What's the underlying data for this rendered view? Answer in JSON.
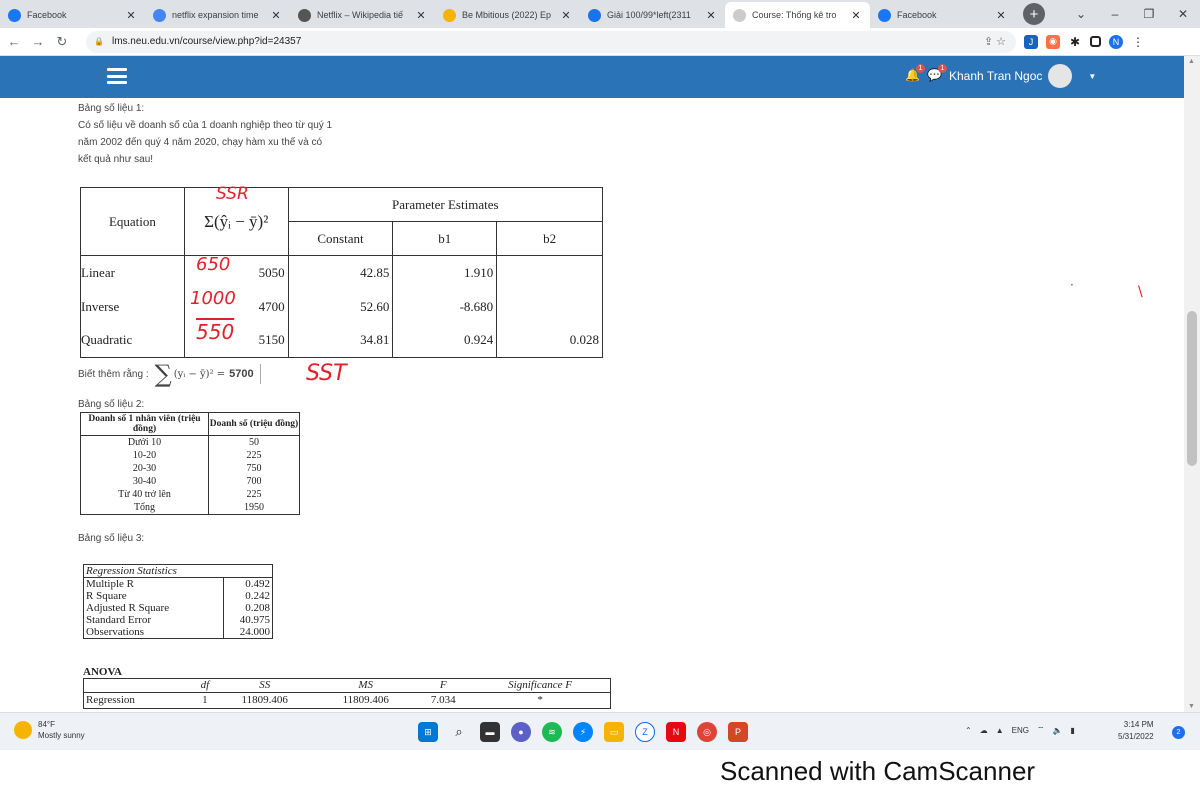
{
  "browser": {
    "tabs": [
      {
        "label": "Facebook",
        "icon": "facebook-icon",
        "color": "#1877f2"
      },
      {
        "label": "netflix expansion time",
        "icon": "google-icon",
        "color": "#4285f4"
      },
      {
        "label": "Netflix – Wikipedia tiế",
        "icon": "wikipedia-icon",
        "color": "#555555"
      },
      {
        "label": "Be Mbitious (2022) Ep",
        "icon": "sheets-icon",
        "color": "#f4b400"
      },
      {
        "label": "Giải 100/99*left(2311",
        "icon": "calc-icon",
        "color": "#1a73e8"
      },
      {
        "label": "Course: Thống kê tro",
        "icon": "course-icon",
        "color": "#cccccc"
      },
      {
        "label": "Facebook",
        "icon": "facebook-icon",
        "color": "#1877f2"
      }
    ],
    "active_tab": 5,
    "url": "lms.neu.edu.vn/course/view.php?id=24357"
  },
  "moodle": {
    "user_name": "Khanh Tran Ngoc",
    "notification_count": "1",
    "message_count": "1"
  },
  "content": {
    "table1_title": "Bảng số liệu 1:",
    "table1_desc": "Có số liệu về doanh số của 1 doanh nghiệp theo từ quý 1 năm 2002 đến quý 4 năm 2020, chạy hàm xu thế và có kết quả như sau!",
    "table1": {
      "h_equation": "Equation",
      "h_sse": "Σ(ŷᵢ − ȳ)²",
      "h_param": "Parameter Estimates",
      "h_const": "Constant",
      "h_b1": "b1",
      "h_b2": "b2",
      "rows": [
        {
          "eq": "Linear",
          "sse": "5050",
          "const": "42.85",
          "b1": "1.910",
          "b2": ""
        },
        {
          "eq": "Inverse",
          "sse": "4700",
          "const": "52.60",
          "b1": "-8.680",
          "b2": ""
        },
        {
          "eq": "Quadratic",
          "sse": "5150",
          "const": "34.81",
          "b1": "0.924",
          "b2": "0.028"
        }
      ]
    },
    "know_label": "Biết thêm rằng :",
    "know_expr": "(yᵢ − ȳ)² =",
    "know_value": "5700",
    "table2_title": "Bảng số liệu 2:",
    "table2": {
      "h1": "Doanh số 1 nhân viên (triệu đồng)",
      "h2": "Doanh số (triệu đồng)",
      "rows": [
        [
          "Dưới 10",
          "50"
        ],
        [
          "10-20",
          "225"
        ],
        [
          "20-30",
          "750"
        ],
        [
          "30-40",
          "700"
        ],
        [
          "Từ 40 trở lên",
          "225"
        ],
        [
          "Tổng",
          "1950"
        ]
      ]
    },
    "table3_title": "Bảng số liệu 3:",
    "table3": {
      "caption": "Regression Statistics",
      "rows": [
        [
          "Multiple R",
          "0.492"
        ],
        [
          "R Square",
          "0.242"
        ],
        [
          "Adjusted R Square",
          "0.208"
        ],
        [
          "Standard Error",
          "40.975"
        ],
        [
          "Observations",
          "24.000"
        ]
      ]
    },
    "anova_title": "ANOVA",
    "anova": {
      "headers": [
        "",
        "df",
        "SS",
        "MS",
        "F",
        "Significance F"
      ],
      "row": [
        "Regression",
        "1",
        "11809.406",
        "11809.406",
        "7.034",
        "*"
      ]
    },
    "handwriting": {
      "ssr": "SSR",
      "linear": "650",
      "inverse": "1000",
      "quadratic": "550",
      "sst": "SST"
    }
  },
  "taskbar": {
    "temperature": "84°F",
    "weather": "Mostly sunny",
    "language": "ENG",
    "time": "3:14 PM",
    "date": "5/31/2022",
    "notifications": "2"
  },
  "watermark": "Scanned with CamScanner"
}
